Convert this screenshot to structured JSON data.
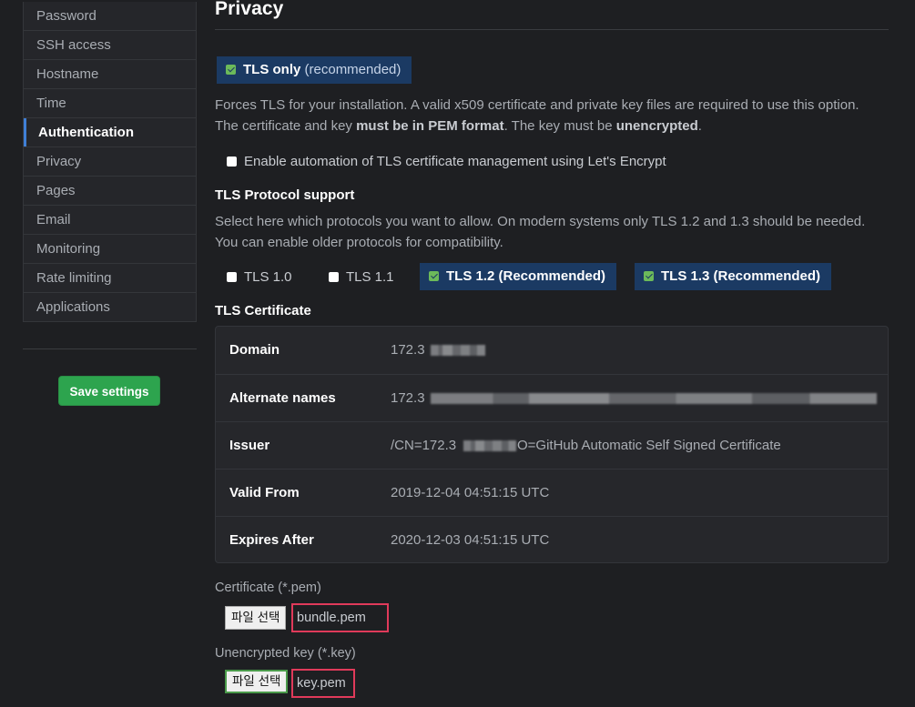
{
  "sidebar": {
    "items": [
      {
        "label": "Password",
        "active": false
      },
      {
        "label": "SSH access",
        "active": false
      },
      {
        "label": "Hostname",
        "active": false
      },
      {
        "label": "Time",
        "active": false
      },
      {
        "label": "Authentication",
        "active": true
      },
      {
        "label": "Privacy",
        "active": false
      },
      {
        "label": "Pages",
        "active": false
      },
      {
        "label": "Email",
        "active": false
      },
      {
        "label": "Monitoring",
        "active": false
      },
      {
        "label": "Rate limiting",
        "active": false
      },
      {
        "label": "Applications",
        "active": false
      }
    ],
    "save_label": "Save settings"
  },
  "main": {
    "title": "Privacy",
    "tls_only": {
      "label": "TLS only",
      "hint": "(recommended)",
      "checked": true
    },
    "tls_description": {
      "part1": "Forces TLS for your installation. A valid x509 certificate and private key files are required to use this option. The certificate and key ",
      "bold1": "must be in PEM format",
      "part2": ". The key must be ",
      "bold2": "unencrypted",
      "part3": "."
    },
    "letsencrypt": {
      "label": "Enable automation of TLS certificate management using Let's Encrypt",
      "checked": false
    },
    "protocol_heading": "TLS Protocol support",
    "protocol_description": "Select here which protocols you want to allow. On modern systems only TLS 1.2 and 1.3 should be needed. You can enable older protocols for compatibility.",
    "protocols": [
      {
        "label": "TLS 1.0",
        "checked": false
      },
      {
        "label": "TLS 1.1",
        "checked": false
      },
      {
        "label": "TLS 1.2 (Recommended)",
        "checked": true
      },
      {
        "label": "TLS 1.3 (Recommended)",
        "checked": true
      }
    ],
    "certificate_heading": "TLS Certificate",
    "certificate": [
      {
        "key": "Domain",
        "value": "172.3"
      },
      {
        "key": "Alternate names",
        "value": "172.3"
      },
      {
        "key": "Issuer",
        "value_prefix": "/CN=172.3",
        "value_suffix": "O=GitHub Automatic Self Signed Certificate"
      },
      {
        "key": "Valid From",
        "value": "2019-12-04 04:51:15 UTC"
      },
      {
        "key": "Expires After",
        "value": "2020-12-03 04:51:15 UTC"
      }
    ],
    "cert_file": {
      "label": "Certificate (*.pem)",
      "button": "파일 선택",
      "filename": "bundle.pem"
    },
    "key_file": {
      "label": "Unencrypted key (*.key)",
      "button": "파일 선택",
      "filename": "key.pem"
    }
  },
  "colors": {
    "background": "#1e1f22",
    "accent_blue": "#3f7fd6",
    "chip_blue": "#1b3a63",
    "save_green": "#2da44e",
    "highlight_red": "#e03a5a"
  }
}
